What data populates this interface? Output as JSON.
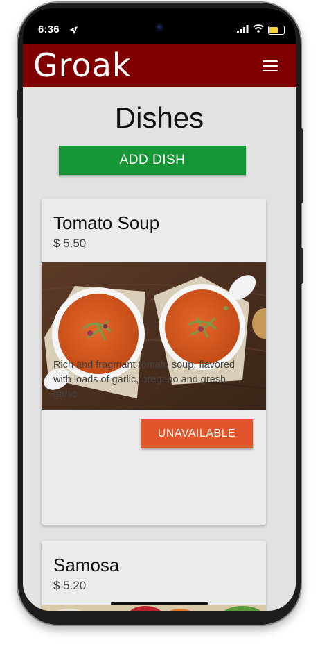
{
  "status_bar": {
    "time": "6:36"
  },
  "app": {
    "logo_text": "Groak",
    "brand_color": "#800000"
  },
  "page": {
    "title": "Dishes"
  },
  "actions": {
    "add_dish_label": "ADD DISH",
    "add_color": "#169736"
  },
  "dishes": [
    {
      "name": "Tomato Soup",
      "price": "$ 5.50",
      "description": "Rich and fragmant tomato soup, flavored with loads of garlic, oregano and gresh garlic.",
      "status_label": "UNAVAILABLE",
      "status_color": "#e2542b"
    },
    {
      "name": "Samosa",
      "price": "$ 5.20"
    }
  ]
}
